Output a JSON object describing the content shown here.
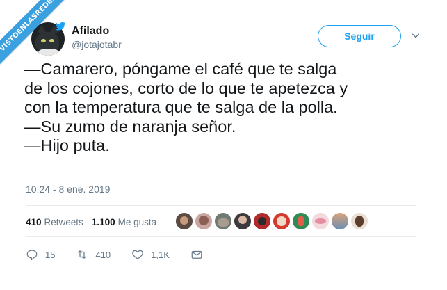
{
  "watermark": "VISTOENLASREDES",
  "tweet": {
    "author_name": "Afilado",
    "author_handle": "@jotajotabr",
    "follow_label": "Seguir",
    "text": "—Camarero, póngame el café que te salga\nde los cojones, corto de lo que te apetezca y\ncon la temperatura que te salga de la polla.\n—Su zumo de naranja señor.\n—Hijo puta.",
    "timestamp": "10:24 - 8 ene. 2019",
    "retweets_count": "410",
    "retweets_label": "Retweets",
    "likes_count": "1.100",
    "likes_label": "Me gusta",
    "replies": "15",
    "retweets_short": "410",
    "likes_short": "1,1K"
  },
  "colors": {
    "accent": "#1da1f2",
    "secondary_text": "#657786",
    "primary_text": "#14171a",
    "ribbon": "#3aa0e0"
  },
  "icons": [
    "twitter-bird-icon",
    "chevron-down-icon",
    "reply-icon",
    "retweet-icon",
    "heart-icon",
    "mail-icon"
  ]
}
